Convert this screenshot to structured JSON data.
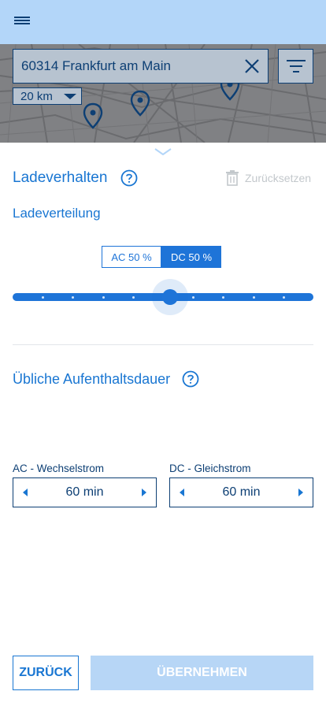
{
  "header": {
    "menu_icon": "hamburger-menu-icon"
  },
  "map": {
    "search": {
      "value": "60314 Frankfurt am Main",
      "clear_icon": "close-icon"
    },
    "filter_icon": "filter-icon",
    "radius": {
      "value": "20 km",
      "icon": "triangle-down-icon"
    }
  },
  "sheet": {
    "handle_icon": "chevron-down-icon",
    "title": "Ladeverhalten",
    "reset_label": "Zurücksetzen",
    "distribution": {
      "label": "Ladeverteilung",
      "ac_label": "AC 50 %",
      "dc_label": "DC 50 %",
      "selected": "DC",
      "slider_value_percent": 50,
      "slider_steps": 10
    },
    "duration": {
      "title": "Übliche Aufenthaltsdauer",
      "ac": {
        "label": "AC - Wechselstrom",
        "value": "60 min"
      },
      "dc": {
        "label": "DC - Gleichstrom",
        "value": "60 min"
      }
    },
    "buttons": {
      "back": "ZURÜCK",
      "apply": "ÜBERNEHMEN"
    }
  },
  "colors": {
    "accent": "#1976d2",
    "header_bg": "#b3d6f9",
    "navy": "#0d3f74",
    "map_bg": "#808184",
    "disabled": "#b7d6f6"
  }
}
